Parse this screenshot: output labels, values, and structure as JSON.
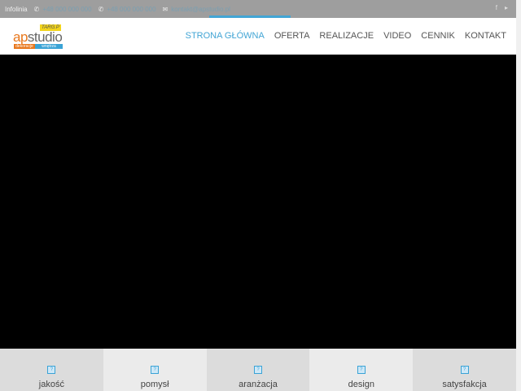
{
  "topbar": {
    "infolinia": "Infolinia",
    "phone1": "+48 000 000 000",
    "phone2": "+48 000 000 000",
    "email": "kontakt@apstudio.pl",
    "social": [
      "f",
      "▸"
    ]
  },
  "logo": {
    "tag": "TARG.P",
    "brand_a": "ap",
    "brand_b": "studio",
    "sub1": "dekoracje",
    "sub2": "wnętrza"
  },
  "nav": {
    "items": [
      "STRONA GŁÓWNA",
      "OFERTA",
      "REALIZACJE",
      "VIDEO",
      "CENNIK",
      "KONTAKT"
    ],
    "active": 0
  },
  "features": [
    "jakość",
    "pomysł",
    "aranżacja",
    "design",
    "satysfakcja"
  ],
  "colors": {
    "accent": "#42a5d5",
    "topbar": "#9e9e9e",
    "hero": "#000000",
    "orange": "#e8771c"
  }
}
